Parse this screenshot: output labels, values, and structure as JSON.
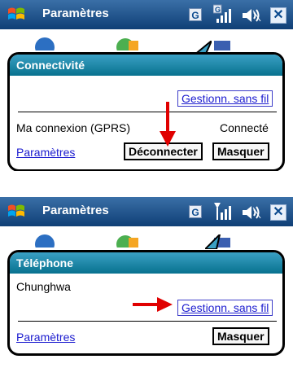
{
  "top": {
    "titlebar": {
      "title": "Paramètres",
      "status_badge": "G"
    },
    "dialog": {
      "title": "Connectivité",
      "wireless_link": "Gestionn. sans fil",
      "connection_name": "Ma connexion (GPRS)",
      "connection_status": "Connecté",
      "settings_link": "Paramètres",
      "disconnect_button": "Déconnecter",
      "hide_button": "Masquer"
    }
  },
  "bottom": {
    "titlebar": {
      "title": "Paramètres",
      "status_badge": "G"
    },
    "dialog": {
      "title": "Téléphone",
      "operator": "Chunghwa",
      "wireless_link": "Gestionn. sans fil",
      "settings_link": "Paramètres",
      "hide_button": "Masquer"
    }
  },
  "colors": {
    "titlebar": "#0f3f76",
    "header": "#08728f",
    "link": "#1b1bcf",
    "arrow": "#e00000"
  },
  "icons": [
    "windows-start-icon",
    "signal-icon",
    "volume-icon",
    "close-icon",
    "red-arrow-icon"
  ]
}
